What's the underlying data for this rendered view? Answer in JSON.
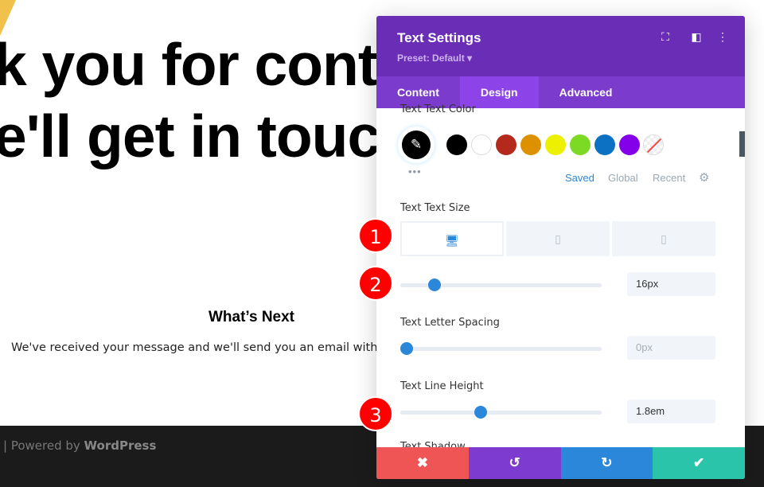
{
  "page": {
    "heading_line1": "k you for cont",
    "heading_line2": "e'll get in touc",
    "whats_next": "What’s Next",
    "message": "We've received your message and we'll send you an email with",
    "footer_prefix": "| Powered by ",
    "footer_brand": "WordPress"
  },
  "panel": {
    "title": "Text Settings",
    "preset": "Preset: Default ▾",
    "tabs": [
      {
        "label": "Content"
      },
      {
        "label": "Design"
      },
      {
        "label": "Advanced"
      }
    ],
    "active_tab": "Design",
    "color": {
      "label": "Text Text Color",
      "swatches": [
        "#000000",
        "#ffffff",
        "#b32a1d",
        "#de9100",
        "#edf000",
        "#7cda24",
        "#0c71c3",
        "#8300e9"
      ],
      "palette_tabs": [
        "Saved",
        "Global",
        "Recent"
      ],
      "active_palette": "Saved"
    },
    "size": {
      "label": "Text Text Size",
      "value": "16px",
      "slider_fraction": 0.17,
      "active_device": "desktop"
    },
    "letter_spacing": {
      "label": "Text Letter Spacing",
      "value": "0px",
      "slider_fraction": 0
    },
    "line_height": {
      "label": "Text Line Height",
      "value": "1.8em",
      "slider_fraction": 0.4
    },
    "next_label_partial": "Text Shadow"
  },
  "badges": [
    "1",
    "2",
    "3"
  ],
  "colors": {
    "header": "#6a2db6",
    "tabs": "#7b3bcc",
    "accent": "#2b87da",
    "cancel": "#ef5555",
    "undo": "#7e3bd0",
    "redo": "#2b87da",
    "save": "#29c4a9"
  }
}
